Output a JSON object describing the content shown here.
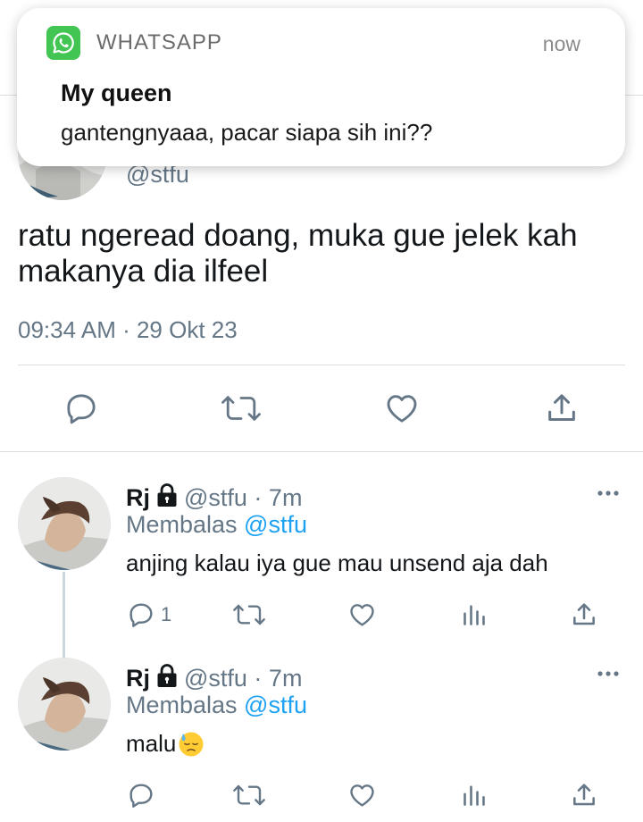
{
  "notification": {
    "app_name": "WHATSAPP",
    "time": "now",
    "title": "My queen",
    "message": "gantengnyaaa, pacar siapa sih ini??",
    "app_icon": "whatsapp-icon",
    "accent_color": "#43c553"
  },
  "main_tweet": {
    "handle": "@stfu",
    "text": "ratu ngeread doang, muka gue jelek kah makanya dia ilfeel",
    "meta": "09:34 AM · 29 Okt 23",
    "actions": [
      "reply-icon",
      "retweet-icon",
      "like-icon",
      "share-icon"
    ]
  },
  "replies": [
    {
      "name": "Rj",
      "handle": "@stfu · 7m",
      "replying_prefix": "Membalas ",
      "replying_to": "@stfu",
      "text": "anjing kalau iya gue mau unsend aja dah",
      "reply_count": "1"
    },
    {
      "name": "Rj",
      "handle": "@stfu · 7m",
      "replying_prefix": "Membalas ",
      "replying_to": "@stfu",
      "text": "malu",
      "emoji": "downcast-face-with-sweat-emoji",
      "reply_count": ""
    }
  ],
  "colors": {
    "link": "#1da1f2",
    "secondary_text": "#657786",
    "icon": "#657786"
  }
}
